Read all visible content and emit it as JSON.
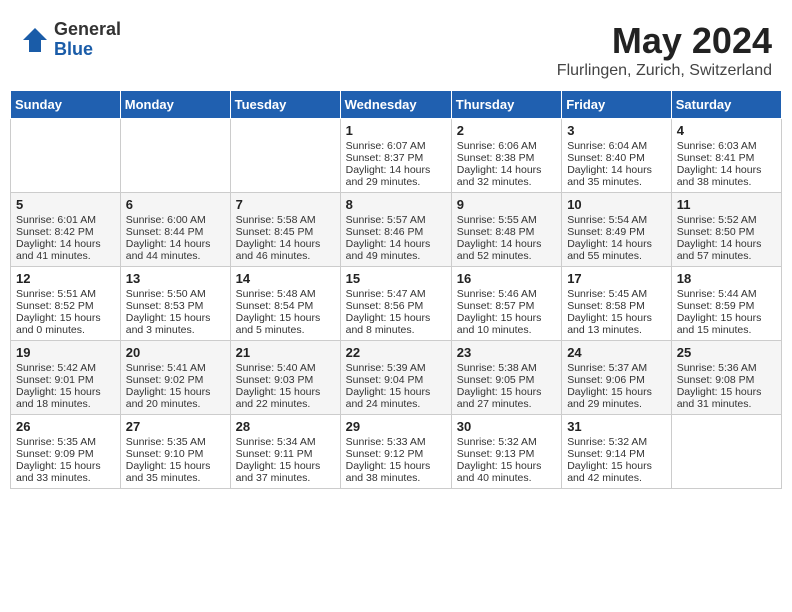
{
  "header": {
    "logo_general": "General",
    "logo_blue": "Blue",
    "month_year": "May 2024",
    "location": "Flurlingen, Zurich, Switzerland"
  },
  "days_of_week": [
    "Sunday",
    "Monday",
    "Tuesday",
    "Wednesday",
    "Thursday",
    "Friday",
    "Saturday"
  ],
  "weeks": [
    [
      {
        "day": "",
        "info": ""
      },
      {
        "day": "",
        "info": ""
      },
      {
        "day": "",
        "info": ""
      },
      {
        "day": "1",
        "info": "Sunrise: 6:07 AM\nSunset: 8:37 PM\nDaylight: 14 hours\nand 29 minutes."
      },
      {
        "day": "2",
        "info": "Sunrise: 6:06 AM\nSunset: 8:38 PM\nDaylight: 14 hours\nand 32 minutes."
      },
      {
        "day": "3",
        "info": "Sunrise: 6:04 AM\nSunset: 8:40 PM\nDaylight: 14 hours\nand 35 minutes."
      },
      {
        "day": "4",
        "info": "Sunrise: 6:03 AM\nSunset: 8:41 PM\nDaylight: 14 hours\nand 38 minutes."
      }
    ],
    [
      {
        "day": "5",
        "info": "Sunrise: 6:01 AM\nSunset: 8:42 PM\nDaylight: 14 hours\nand 41 minutes."
      },
      {
        "day": "6",
        "info": "Sunrise: 6:00 AM\nSunset: 8:44 PM\nDaylight: 14 hours\nand 44 minutes."
      },
      {
        "day": "7",
        "info": "Sunrise: 5:58 AM\nSunset: 8:45 PM\nDaylight: 14 hours\nand 46 minutes."
      },
      {
        "day": "8",
        "info": "Sunrise: 5:57 AM\nSunset: 8:46 PM\nDaylight: 14 hours\nand 49 minutes."
      },
      {
        "day": "9",
        "info": "Sunrise: 5:55 AM\nSunset: 8:48 PM\nDaylight: 14 hours\nand 52 minutes."
      },
      {
        "day": "10",
        "info": "Sunrise: 5:54 AM\nSunset: 8:49 PM\nDaylight: 14 hours\nand 55 minutes."
      },
      {
        "day": "11",
        "info": "Sunrise: 5:52 AM\nSunset: 8:50 PM\nDaylight: 14 hours\nand 57 minutes."
      }
    ],
    [
      {
        "day": "12",
        "info": "Sunrise: 5:51 AM\nSunset: 8:52 PM\nDaylight: 15 hours\nand 0 minutes."
      },
      {
        "day": "13",
        "info": "Sunrise: 5:50 AM\nSunset: 8:53 PM\nDaylight: 15 hours\nand 3 minutes."
      },
      {
        "day": "14",
        "info": "Sunrise: 5:48 AM\nSunset: 8:54 PM\nDaylight: 15 hours\nand 5 minutes."
      },
      {
        "day": "15",
        "info": "Sunrise: 5:47 AM\nSunset: 8:56 PM\nDaylight: 15 hours\nand 8 minutes."
      },
      {
        "day": "16",
        "info": "Sunrise: 5:46 AM\nSunset: 8:57 PM\nDaylight: 15 hours\nand 10 minutes."
      },
      {
        "day": "17",
        "info": "Sunrise: 5:45 AM\nSunset: 8:58 PM\nDaylight: 15 hours\nand 13 minutes."
      },
      {
        "day": "18",
        "info": "Sunrise: 5:44 AM\nSunset: 8:59 PM\nDaylight: 15 hours\nand 15 minutes."
      }
    ],
    [
      {
        "day": "19",
        "info": "Sunrise: 5:42 AM\nSunset: 9:01 PM\nDaylight: 15 hours\nand 18 minutes."
      },
      {
        "day": "20",
        "info": "Sunrise: 5:41 AM\nSunset: 9:02 PM\nDaylight: 15 hours\nand 20 minutes."
      },
      {
        "day": "21",
        "info": "Sunrise: 5:40 AM\nSunset: 9:03 PM\nDaylight: 15 hours\nand 22 minutes."
      },
      {
        "day": "22",
        "info": "Sunrise: 5:39 AM\nSunset: 9:04 PM\nDaylight: 15 hours\nand 24 minutes."
      },
      {
        "day": "23",
        "info": "Sunrise: 5:38 AM\nSunset: 9:05 PM\nDaylight: 15 hours\nand 27 minutes."
      },
      {
        "day": "24",
        "info": "Sunrise: 5:37 AM\nSunset: 9:06 PM\nDaylight: 15 hours\nand 29 minutes."
      },
      {
        "day": "25",
        "info": "Sunrise: 5:36 AM\nSunset: 9:08 PM\nDaylight: 15 hours\nand 31 minutes."
      }
    ],
    [
      {
        "day": "26",
        "info": "Sunrise: 5:35 AM\nSunset: 9:09 PM\nDaylight: 15 hours\nand 33 minutes."
      },
      {
        "day": "27",
        "info": "Sunrise: 5:35 AM\nSunset: 9:10 PM\nDaylight: 15 hours\nand 35 minutes."
      },
      {
        "day": "28",
        "info": "Sunrise: 5:34 AM\nSunset: 9:11 PM\nDaylight: 15 hours\nand 37 minutes."
      },
      {
        "day": "29",
        "info": "Sunrise: 5:33 AM\nSunset: 9:12 PM\nDaylight: 15 hours\nand 38 minutes."
      },
      {
        "day": "30",
        "info": "Sunrise: 5:32 AM\nSunset: 9:13 PM\nDaylight: 15 hours\nand 40 minutes."
      },
      {
        "day": "31",
        "info": "Sunrise: 5:32 AM\nSunset: 9:14 PM\nDaylight: 15 hours\nand 42 minutes."
      },
      {
        "day": "",
        "info": ""
      }
    ]
  ]
}
